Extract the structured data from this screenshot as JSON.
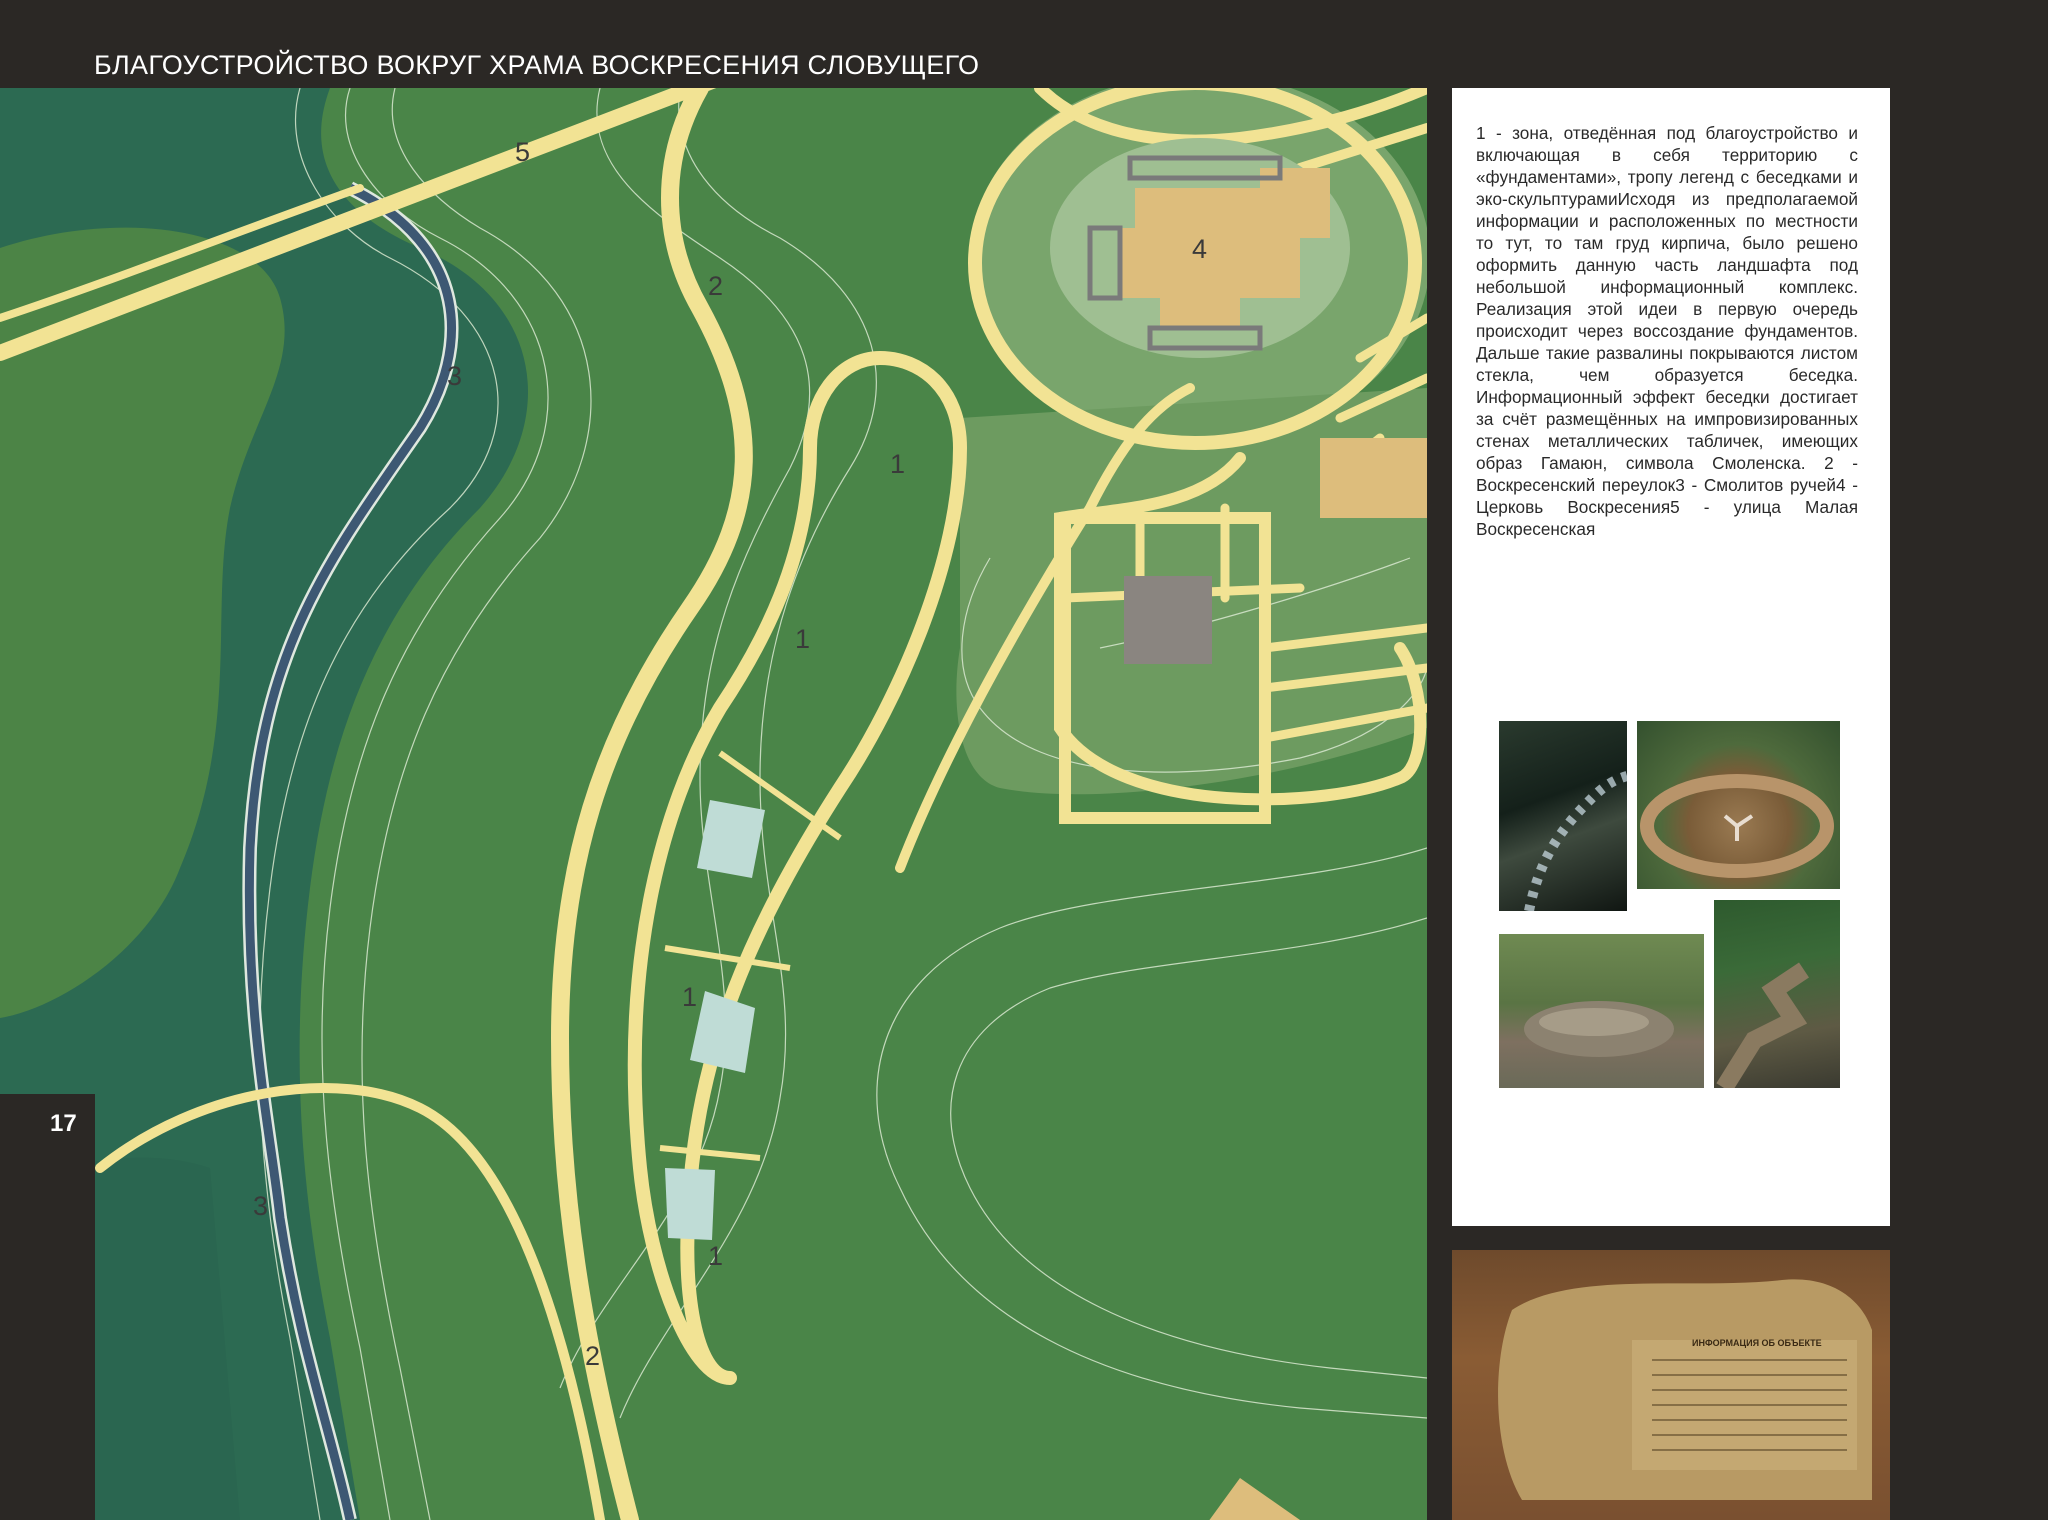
{
  "title": "БЛАГОУСТРОЙСТВО ВОКРУГ ХРАМА ВОСКРЕСЕНИЯ СЛОВУЩЕГО",
  "page_number": "17",
  "description": "1 - зона, отведённая под благоустройство и включающая в себя территорию с «фундаментами», тропу легенд с беседками и эко-скульптурамиИсходя из предполагаемой информации и расположенных по местности то тут, то там груд кирпича, было решено оформить данную часть ландшафта под небольшой информационный комплекс. Реализация этой идеи в первую очередь происходит через воссоздание фундаментов. Дальше такие развалины покрываются листом стекла, чем образуется беседка. Информационный эффект беседки достигает за счёт размещённых на импровизированных стенах металлических табличек, имеющих образ Гамаюн, символа Смоленска. 2 - Воскресенский переулок3 - Смолитов ручей4 - Церковь Воскресения5 - улица Малая Воскресенская",
  "map_labels": {
    "zone1_a": "1",
    "zone1_b": "1",
    "zone1_c": "1",
    "zone1_d": "1",
    "lane2_a": "2",
    "lane2_b": "2",
    "stream3_a": "3",
    "stream3_b": "3",
    "church4": "4",
    "street5": "5"
  },
  "plaque_heading": "ИНФОРМАЦИЯ ОБ ОБЪЕКТЕ",
  "colors": {
    "background": "#2b2825",
    "grass": "#4f8a4b",
    "grass_dark": "#2c6a4e",
    "road": "#f2e394",
    "stream": "#3d5873",
    "church": "#ddbd7c",
    "glass": "#bfdcd6",
    "square": "#8a8580"
  }
}
